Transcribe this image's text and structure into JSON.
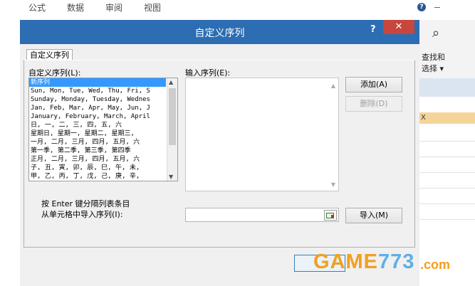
{
  "ribbon": {
    "tabs": [
      "公式",
      "数据",
      "审阅",
      "视图"
    ]
  },
  "dialog": {
    "title": "自定义序列",
    "help_glyph": "?",
    "close_glyph": "✕",
    "tab_label": "自定义序列",
    "custom_lists_label": "自定义序列(L):",
    "input_label": "输入序列(E):",
    "list_items": [
      "新序列",
      "Sun, Mon, Tue, Wed, Thu, Fri, S",
      "Sunday, Monday, Tuesday, Wednes",
      "Jan, Feb, Mar, Apr, May, Jun, J",
      "January, February, March, April",
      "日, 一, 二, 三, 四, 五, 六",
      "星期日, 星期一, 星期二, 星期三,",
      "一月, 二月, 三月, 四月, 五月, 六",
      "第一季, 第二季, 第三季, 第四季",
      "正月, 二月, 三月, 四月, 五月, 六",
      "子, 丑, 寅, 卯, 辰, 巳, 午, 未,",
      "甲, 乙, 丙, 丁, 戊, 己, 庚, 辛,"
    ],
    "add_button": "添加(A)",
    "delete_button": "删除(D)",
    "hint": "按 Enter 键分隔列表条目",
    "import_label": "从单元格中导入序列(I):",
    "import_button": "导入(M)"
  },
  "right_panel": {
    "find_label_1": "查找和",
    "find_label_2": "选择 ▾",
    "col_header": "X"
  },
  "watermark": {
    "game": "GAME",
    "num": "773",
    "com": ".com"
  }
}
